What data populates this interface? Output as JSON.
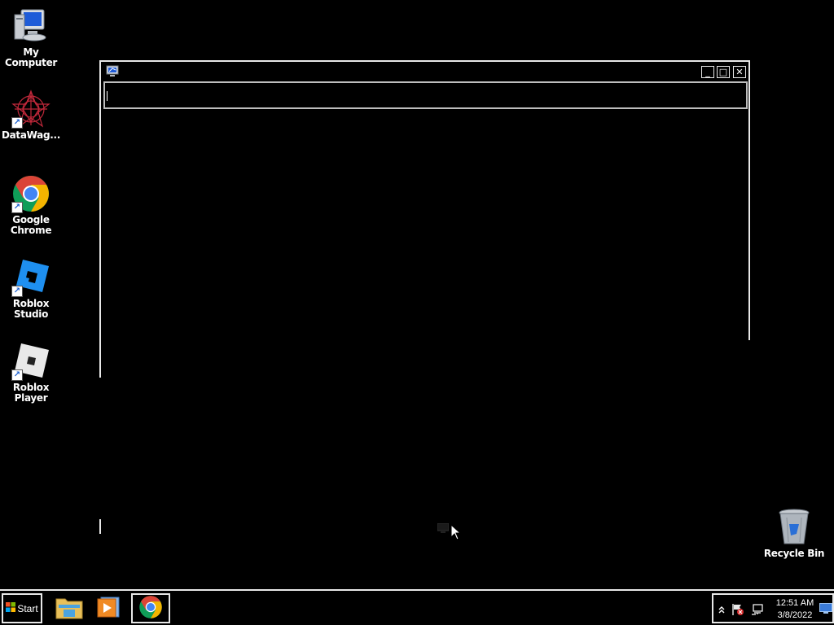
{
  "desktop": {
    "icons": [
      {
        "label": "My Computer",
        "icon": "computer-icon"
      },
      {
        "label": "DataWag...",
        "icon": "datawag-icon"
      },
      {
        "label": "Google Chrome",
        "icon": "chrome-icon"
      },
      {
        "label": "Roblox Studio",
        "icon": "roblox-studio-icon"
      },
      {
        "label": "Roblox Player",
        "icon": "roblox-player-icon"
      },
      {
        "label": "Recycle Bin",
        "icon": "recycle-bin-icon"
      }
    ]
  },
  "window": {
    "title_icon": "computer-monitor-icon",
    "controls": {
      "minimize": "_",
      "maximize": "□",
      "close": "✕"
    },
    "address_value": ""
  },
  "taskbar": {
    "start_label": "Start",
    "buttons": [
      {
        "name": "file-explorer",
        "icon": "folder-icon",
        "active": false
      },
      {
        "name": "media-player",
        "icon": "media-player-icon",
        "active": false
      },
      {
        "name": "chrome",
        "icon": "chrome-icon",
        "active": true
      }
    ],
    "tray": {
      "icons": [
        "chevron-up-icon",
        "action-center-flag-icon",
        "network-icon"
      ],
      "time": "12:51 AM",
      "date": "3/8/2022",
      "show_desktop_icon": "show-desktop-icon"
    }
  },
  "colors": {
    "background": "#000000",
    "frame": "#e8e8e8",
    "chrome_red": "#db4437",
    "chrome_green": "#0f9d58",
    "chrome_yellow": "#f4b400",
    "chrome_blue": "#4285f4",
    "roblox_blue": "#1e8ff0"
  }
}
